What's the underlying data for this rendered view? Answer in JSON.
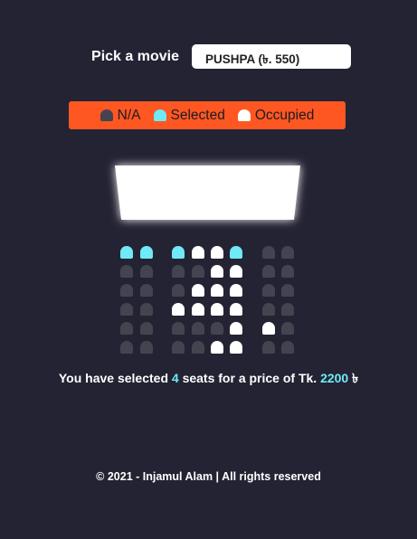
{
  "picker": {
    "label": "Pick a movie",
    "selected": "PUSHPA (৳. 550)"
  },
  "legend": {
    "items": [
      {
        "label": "N/A",
        "state": "na"
      },
      {
        "label": "Selected",
        "state": "selected"
      },
      {
        "label": "Occupied",
        "state": "occupied"
      }
    ]
  },
  "colors": {
    "background": "#242333",
    "legend_bar": "#fe5722",
    "na": "#444451",
    "selected": "#6feaf6",
    "occupied": "#ffffff",
    "accent": "#6feaf6"
  },
  "seat_map": {
    "rows": [
      [
        "selected",
        "selected",
        "selected",
        "occupied",
        "occupied",
        "selected",
        "na",
        "na"
      ],
      [
        "na",
        "na",
        "na",
        "na",
        "occupied",
        "occupied",
        "na",
        "na"
      ],
      [
        "na",
        "na",
        "na",
        "occupied",
        "occupied",
        "occupied",
        "na",
        "na"
      ],
      [
        "na",
        "na",
        "occupied",
        "occupied",
        "occupied",
        "occupied",
        "na",
        "na"
      ],
      [
        "na",
        "na",
        "na",
        "na",
        "na",
        "occupied",
        "occupied",
        "na"
      ],
      [
        "na",
        "na",
        "na",
        "na",
        "occupied",
        "occupied",
        "na",
        "na"
      ]
    ]
  },
  "summary": {
    "prefix": "You have selected ",
    "count": "4",
    "middle": " seats for a price of Tk. ",
    "total": "2200",
    "suffix": " ৳"
  },
  "footer": {
    "text": "© 2021 - Injamul Alam | All rights reserved"
  }
}
